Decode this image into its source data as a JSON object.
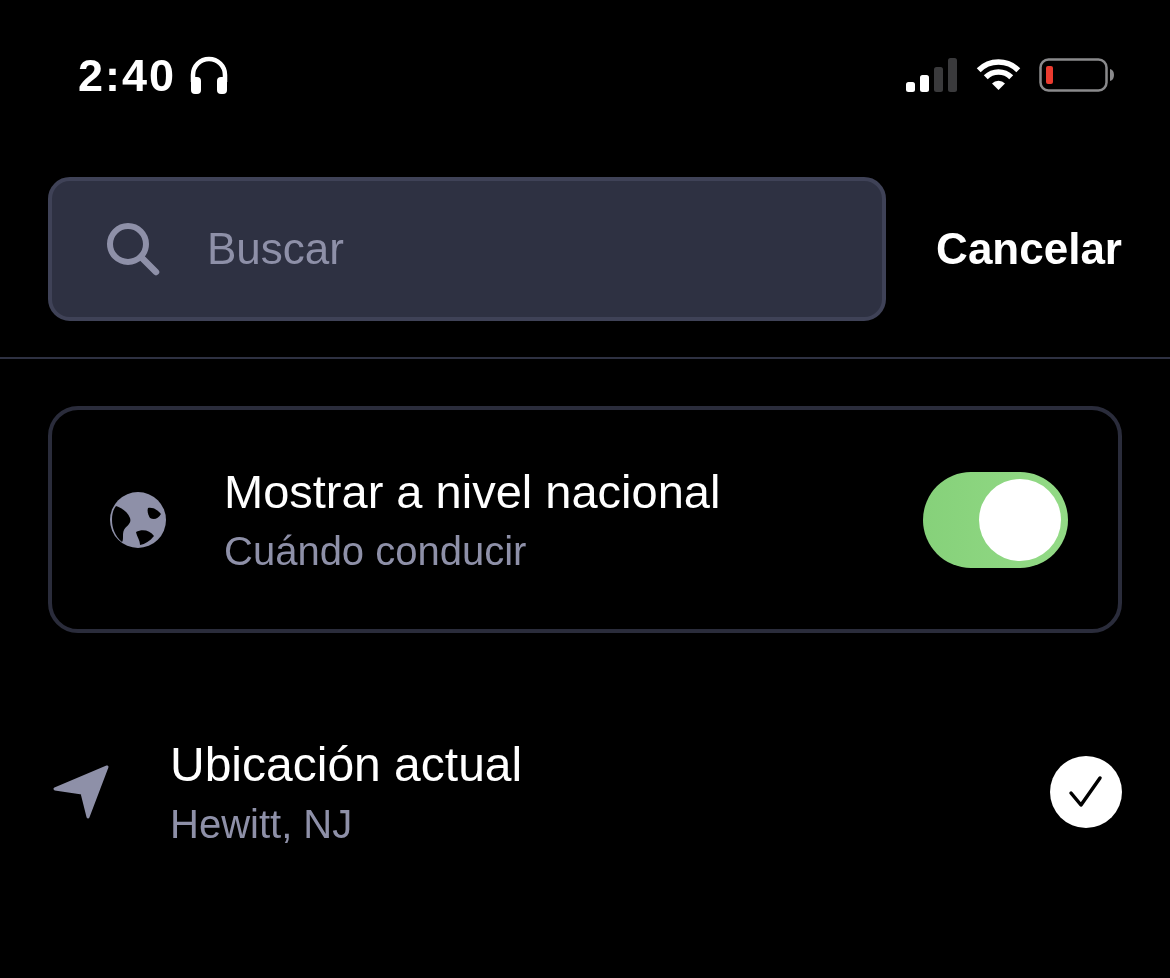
{
  "status_bar": {
    "time": "2:40"
  },
  "search": {
    "placeholder": "Buscar"
  },
  "cancel_button": {
    "label": "Cancelar"
  },
  "nationwide_option": {
    "title": "Mostrar a nivel nacional",
    "subtitle": "Cuándo conducir",
    "on": true
  },
  "locations": [
    {
      "title": "Ubicación actual",
      "subtitle": "Hewitt, NJ",
      "selected": true
    }
  ]
}
